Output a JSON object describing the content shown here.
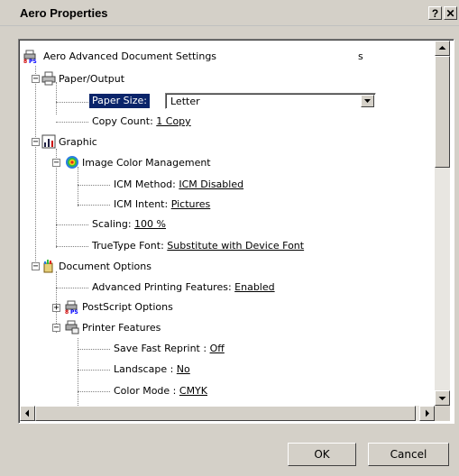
{
  "window": {
    "title": "Aero Properties",
    "help_button": "?",
    "close_button": "✕"
  },
  "tree": {
    "root": "Aero Advanced Document Settings",
    "root_suffix": "s",
    "paper_output": "Paper/Output",
    "paper_size_label": "Paper Size:",
    "paper_size_value": "Letter",
    "copy_count_label": "Copy Count:",
    "copy_count_value": "1 Copy",
    "graphic": "Graphic",
    "icm": "Image Color Management",
    "icm_method_label": "ICM Method:",
    "icm_method_value": "ICM Disabled",
    "icm_intent_label": "ICM Intent:",
    "icm_intent_value": "Pictures",
    "scaling_label": "Scaling:",
    "scaling_value": "100 %",
    "truetype_label": "TrueType Font:",
    "truetype_value": "Substitute with Device Font",
    "document_options": "Document Options",
    "advanced_label": "Advanced Printing Features:",
    "advanced_value": "Enabled",
    "postscript_options": "PostScript Options",
    "printer_features": "Printer Features",
    "save_fast_label": "Save Fast Reprint :",
    "save_fast_value": "Off",
    "landscape_label": "Landscape :",
    "landscape_value": "No",
    "color_mode_label": "Color Mode :",
    "color_mode_value": "CMYK"
  },
  "buttons": {
    "ok": "OK",
    "cancel": "Cancel"
  },
  "colors": {
    "selection": "#0a246a",
    "dialog_bg": "#d4d0c8"
  }
}
